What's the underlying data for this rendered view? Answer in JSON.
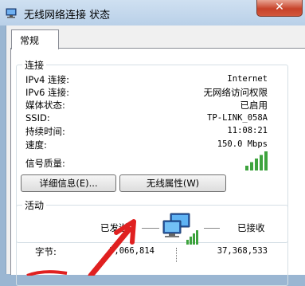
{
  "window": {
    "title": "无线网络连接 状态",
    "close_label": "✕"
  },
  "tabs": [
    {
      "label": "常规"
    }
  ],
  "connection": {
    "group_label": "连接",
    "rows": [
      {
        "label": "IPv4 连接:",
        "value": "Internet"
      },
      {
        "label": "IPv6 连接:",
        "value": "无网络访问权限"
      },
      {
        "label": "媒体状态:",
        "value": "已启用"
      },
      {
        "label": "SSID:",
        "value": "TP-LINK_058A"
      },
      {
        "label": "持续时间:",
        "value": "11:08:21"
      },
      {
        "label": "速度:",
        "value": "150.0 Mbps"
      }
    ],
    "signal_label": "信号质量:",
    "signal_bars_filled": 5,
    "details_button": "详细信息(E)...",
    "wireless_props_button": "无线属性(W)"
  },
  "activity": {
    "group_label": "活动",
    "sent_label": "已发送",
    "received_label": "已接收",
    "bytes_label": "字节:",
    "bytes_sent": "3,066,814",
    "bytes_received": "37,368,533"
  },
  "colors": {
    "annotation_arrow": "#e02020",
    "signal_green": "#3da33d"
  }
}
